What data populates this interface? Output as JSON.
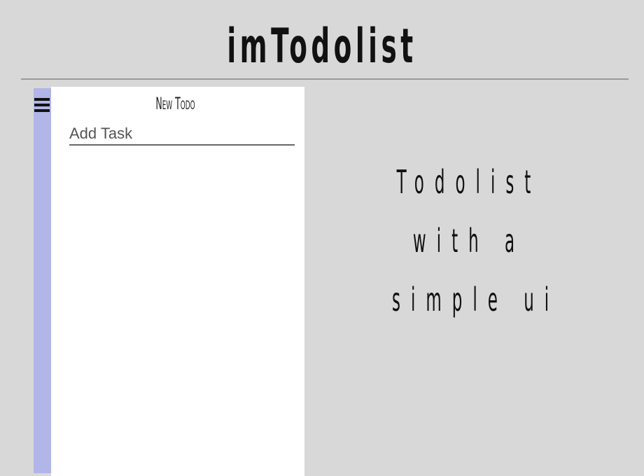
{
  "header": {
    "title": "imTodolist"
  },
  "sidebar": {
    "menu_icon": "hamburger-menu-icon",
    "accent_color": "#b1b5e8"
  },
  "panel": {
    "heading": "New Todo",
    "input": {
      "placeholder": "Add Task",
      "value": ""
    }
  },
  "tagline": {
    "lines": [
      "Todolist",
      "with a",
      "simple ui"
    ]
  },
  "colors": {
    "background": "#d8d8d8",
    "panel": "#ffffff",
    "text": "#111111"
  }
}
